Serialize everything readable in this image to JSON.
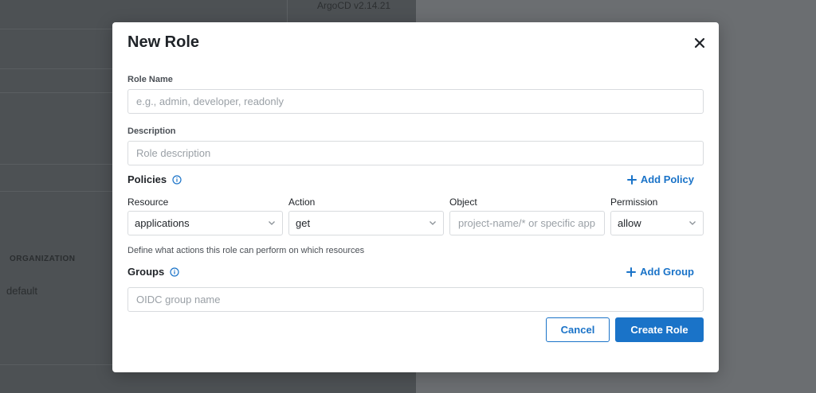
{
  "background": {
    "version": "ArgoCD v2.14.21",
    "org_label": "ORGANIZATION",
    "org_value": "default"
  },
  "modal": {
    "title": "New Role",
    "role_name": {
      "label": "Role Name",
      "value": "",
      "placeholder": "e.g., admin, developer, readonly"
    },
    "description": {
      "label": "Description",
      "value": "",
      "placeholder": "Role description"
    },
    "policies": {
      "title": "Policies",
      "add_label": "Add Policy",
      "columns": {
        "resource": "Resource",
        "action": "Action",
        "object": "Object",
        "permission": "Permission"
      },
      "row": {
        "resource": "applications",
        "action": "get",
        "object_value": "",
        "object_placeholder": "project-name/* or specific app",
        "permission": "allow"
      },
      "hint": "Define what actions this role can perform on which resources"
    },
    "groups": {
      "title": "Groups",
      "add_label": "Add Group",
      "placeholder": "OIDC group name",
      "value": ""
    },
    "buttons": {
      "cancel": "Cancel",
      "create": "Create Role"
    }
  },
  "colors": {
    "accent": "#1a73c8",
    "overlay_left": "#4d5154",
    "overlay_right": "#6b6e71"
  },
  "icons": {
    "close": "close-icon",
    "info": "info-icon",
    "plus": "plus-icon",
    "chevron": "chevron-down-icon"
  }
}
